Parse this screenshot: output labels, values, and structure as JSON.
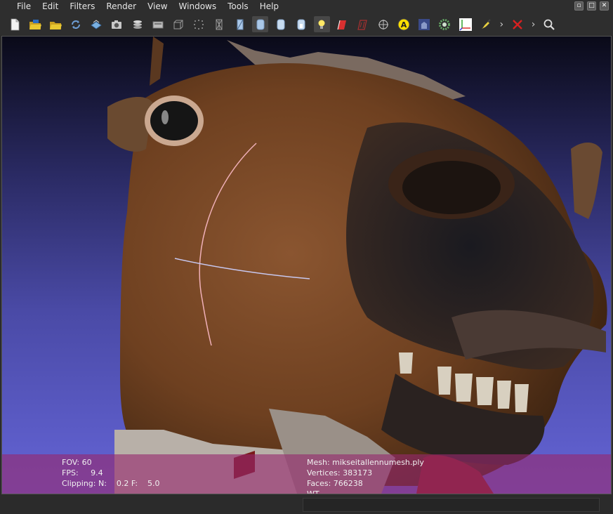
{
  "menu": {
    "items": [
      "File",
      "Edit",
      "Filters",
      "Render",
      "View",
      "Windows",
      "Tools",
      "Help"
    ]
  },
  "window_controls": [
    "restore",
    "maximize",
    "close"
  ],
  "toolbar": {
    "buttons": [
      {
        "name": "new-project-icon",
        "color": "#f2f2f2"
      },
      {
        "name": "open-project-icon",
        "color": "#e8c832"
      },
      {
        "name": "import-mesh-icon",
        "color": "#e8c832"
      },
      {
        "name": "reload-icon",
        "color": "#6fa0d8"
      },
      {
        "name": "export-mesh-icon",
        "color": "#7ab0e0"
      },
      {
        "name": "snapshot-icon",
        "color": "#c8c8c8"
      },
      {
        "name": "layers-icon",
        "color": "#d8d8d8"
      },
      {
        "name": "raster-icon",
        "color": "#bcbcbc"
      },
      {
        "name": "bounding-box-icon",
        "color": "#9a9a9a"
      },
      {
        "name": "points-icon",
        "color": "#9a9a9a"
      },
      {
        "name": "wireframe-icon",
        "color": "#9a9a9a"
      },
      {
        "name": "hidden-lines-icon",
        "color": "#aac8e8"
      },
      {
        "name": "flat-lines-icon",
        "color": "#aac8e8"
      },
      {
        "name": "flat-shading-icon",
        "color": "#c8dcf0"
      },
      {
        "name": "smooth-shading-icon",
        "color": "#c8dcf0"
      },
      {
        "name": "lighting-icon",
        "color": "#ffe866"
      },
      {
        "name": "backface-icon",
        "color": "#d83030"
      },
      {
        "name": "selected-faces-icon",
        "color": "#a83030"
      },
      {
        "name": "manipulator-icon",
        "color": "#bbbbbb"
      },
      {
        "name": "annotation-icon",
        "color": "#ffe000"
      },
      {
        "name": "view-from-icon",
        "color": "#6a7ab8"
      },
      {
        "name": "settings-gear-icon",
        "color": "#66aa66"
      },
      {
        "name": "axes-icon",
        "color": "#ffffff"
      },
      {
        "name": "paint-tool-icon",
        "color": "#e8d040"
      },
      {
        "name": "delete-selection-icon",
        "color": "#d82020"
      },
      {
        "name": "search-icon",
        "color": "#e0e0e0"
      }
    ],
    "active": [
      "hidden-lines-icon",
      "flat-lines-icon",
      "flat-shading-icon",
      "smooth-shading-icon",
      "lighting-icon"
    ]
  },
  "viewport": {
    "info_left": {
      "fov": "FOV: 60",
      "fps": "FPS:     9.4",
      "clipping": "Clipping: N:    0.2 F:    5.0"
    },
    "info_right": {
      "mesh": "Mesh: mikseitallennumesh.ply",
      "vertices": "Vertices: 383173",
      "faces": "Faces: 766238",
      "extra": "WT"
    },
    "colors": {
      "background_top": "#0a0a18",
      "background_bottom": "#6464d6",
      "info_panel": "#962870",
      "trackball_circle": "#f0b0b8",
      "trackball_line": "#c8c8f0"
    }
  }
}
